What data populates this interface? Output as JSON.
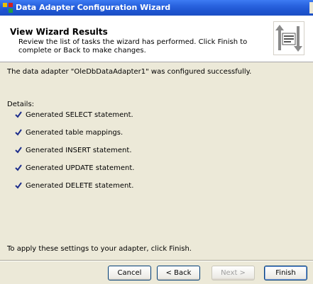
{
  "window": {
    "title": "Data Adapter Configuration Wizard"
  },
  "header": {
    "title": "View Wizard Results",
    "subtitle": "Review the list of tasks the wizard has performed. Click Finish to complete or Back to make changes."
  },
  "body": {
    "message": "The data adapter \"OleDbDataAdapter1\" was configured successfully.",
    "details_label": "Details:",
    "tasks": [
      "Generated SELECT statement.",
      "Generated table mappings.",
      "Generated INSERT statement.",
      "Generated UPDATE statement.",
      "Generated DELETE statement."
    ],
    "footer_text": "To apply these settings to your adapter, click Finish."
  },
  "buttons": {
    "cancel": "Cancel",
    "back": "< Back",
    "next": "Next >",
    "finish": "Finish"
  },
  "colors": {
    "titlebar": "#1e55d0",
    "dialog_bg": "#ece9d8",
    "check": "#1c2d8c"
  },
  "icons": {
    "app": "data-adapter-icon",
    "header": "wizard-arrows-icon",
    "task": "checkmark-icon"
  }
}
